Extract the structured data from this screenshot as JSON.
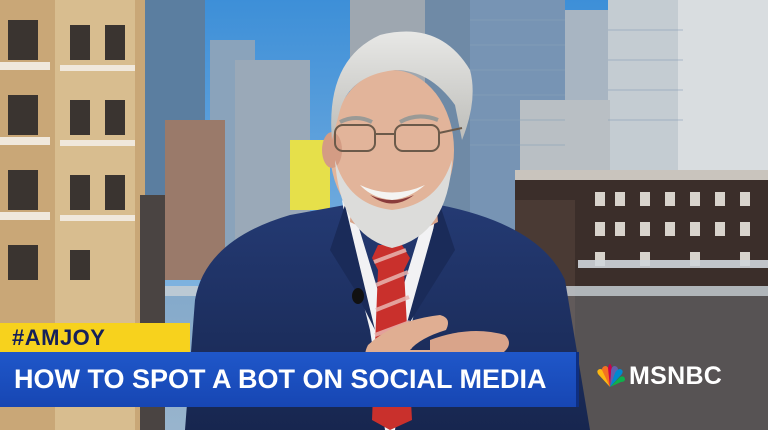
{
  "broadcast": {
    "hashtag": "#AMJOY",
    "headline": "HOW TO SPOT A BOT ON SOCIAL MEDIA",
    "network": "MSNBC"
  },
  "colors": {
    "hashtag_bar": "#f7d21d",
    "hashtag_text": "#15205a",
    "headline_bar": "#1f57c9",
    "headline_text": "#ffffff",
    "suit": "#1c2d5e",
    "tie": "#c9302c"
  },
  "icons": {
    "network_logo": "peacock-icon"
  }
}
